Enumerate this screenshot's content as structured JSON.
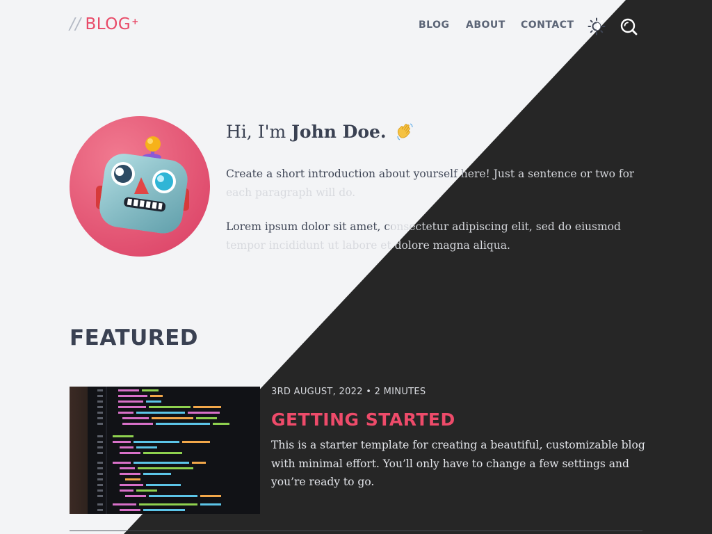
{
  "header": {
    "logo_slashes": "//",
    "logo_text": "BLOG",
    "logo_plus": "+",
    "nav": [
      {
        "label": "BLOG"
      },
      {
        "label": "ABOUT"
      },
      {
        "label": "CONTACT"
      }
    ],
    "theme_toggle_icon": "sun-moon-icon",
    "search_icon": "search-icon"
  },
  "hero": {
    "greeting_prefix": "Hi, I'm ",
    "greeting_name": "John Doe.",
    "wave_icon": "waving-hand-icon",
    "avatar_icon": "robot-face-icon",
    "paragraphs": [
      "Create a short introduction about yourself here! Just a sentence or two for each paragraph will do.",
      "Lorem ipsum dolor sit amet, consectetur adipiscing elit, sed do eiusmod tempor incididunt ut labore et dolore magna aliqua."
    ]
  },
  "featured": {
    "heading": "FEATURED",
    "post": {
      "date": "3RD AUGUST, 2022",
      "separator": " • ",
      "read_time": "2 MINUTES",
      "title": "GETTING STARTED",
      "excerpt": "This is a starter template for creating a beautiful, customizable blog with minimal effort. You’ll only have to change a few settings and you’re ready to go.",
      "image_icon": "code-screenshot-image"
    }
  },
  "colors": {
    "light_bg": "#f3f4f6",
    "dark_bg": "#262626",
    "accent": "#e84a68",
    "text_dark": "#3a4152"
  }
}
